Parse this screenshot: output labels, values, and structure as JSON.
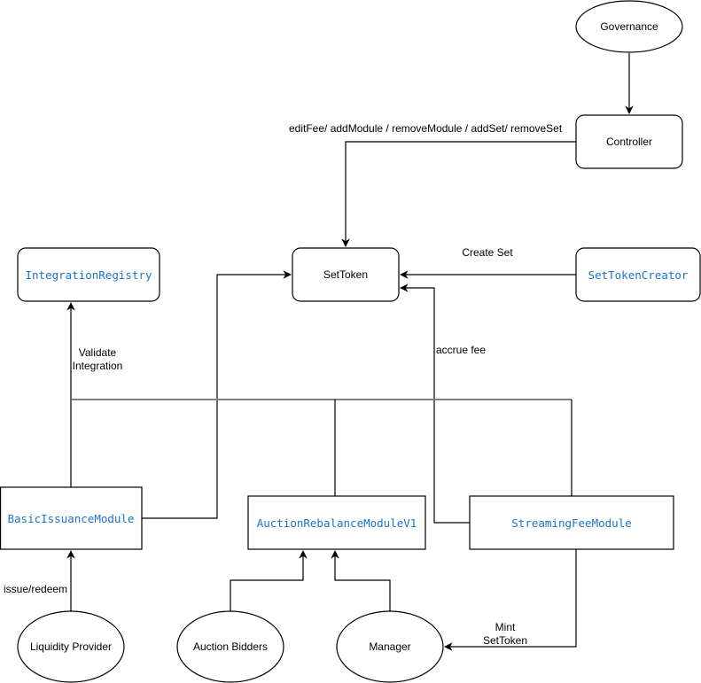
{
  "diagram": {
    "colors": {
      "contract_text": "#1a73c8",
      "line": "#000000",
      "bus_line": "#808080",
      "background": "#ffffff"
    },
    "nodes": {
      "governance": {
        "label": "Governance",
        "shape": "ellipse",
        "style": "plain"
      },
      "controller": {
        "label": "Controller",
        "shape": "rounded-rect",
        "style": "plain"
      },
      "set_token": {
        "label": "SetToken",
        "shape": "rounded-rect",
        "style": "plain"
      },
      "integration_registry": {
        "label": "IntegrationRegistry",
        "shape": "rounded-rect",
        "style": "code"
      },
      "set_token_creator": {
        "label": "SetTokenCreator",
        "shape": "rounded-rect",
        "style": "code"
      },
      "basic_issuance_module": {
        "label": "BasicIssuanceModule",
        "shape": "rect",
        "style": "code"
      },
      "auction_rebalance_module": {
        "label": "AuctionRebalanceModuleV1",
        "shape": "rect",
        "style": "code"
      },
      "streaming_fee_module": {
        "label": "StreamingFeeModule",
        "shape": "rect",
        "style": "code"
      },
      "liquidity_provider": {
        "label": "Liquidity Provider",
        "shape": "ellipse",
        "style": "plain"
      },
      "auction_bidders": {
        "label": "Auction Bidders",
        "shape": "ellipse",
        "style": "plain"
      },
      "manager": {
        "label": "Manager",
        "shape": "ellipse",
        "style": "plain"
      }
    },
    "edges": [
      {
        "from": "governance",
        "to": "controller",
        "label": ""
      },
      {
        "from": "controller",
        "to": "set_token",
        "label": "editFee/ addModule / removeModule / addSet/ removeSet"
      },
      {
        "from": "set_token_creator",
        "to": "set_token",
        "label": "Create Set"
      },
      {
        "from": "streaming_fee_module",
        "to": "set_token",
        "label": "accrue fee"
      },
      {
        "from": "basic_issuance_module",
        "to": "set_token",
        "label": ""
      },
      {
        "from": "modules_bus",
        "to": "integration_registry",
        "label": "Validate Integration"
      },
      {
        "from": "liquidity_provider",
        "to": "basic_issuance_module",
        "label": "issue/redeem"
      },
      {
        "from": "auction_bidders",
        "to": "auction_rebalance_module",
        "label": ""
      },
      {
        "from": "manager",
        "to": "auction_rebalance_module",
        "label": ""
      },
      {
        "from": "streaming_fee_module",
        "to": "manager",
        "label": "Mint SetToken"
      }
    ],
    "edge_labels": {
      "controller_actions": "editFee/ addModule / removeModule / addSet/ removeSet",
      "create_set": "Create Set",
      "accrue_fee": "accrue fee",
      "validate_line1": "Validate",
      "validate_line2": "Integration",
      "issue_redeem": "issue/redeem",
      "mint_line1": "Mint",
      "mint_line2": "SetToken"
    }
  }
}
